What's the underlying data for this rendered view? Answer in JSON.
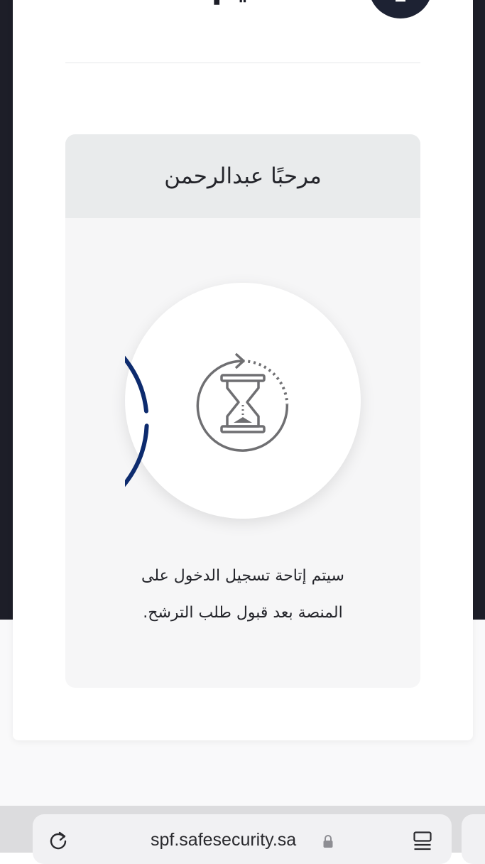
{
  "header": {
    "title": "التقديم",
    "icon": "monitor-download-icon"
  },
  "panel": {
    "welcome_text": "مرحبًا عبدالرحمن",
    "status_icon": "hourglass-refresh-icon",
    "message_line1": "سيتم إتاحة تسجيل الدخول على",
    "message_line2": "المنصة بعد قبول طلب الترشح."
  },
  "browser": {
    "url": "spf.safesecurity.sa",
    "reload_icon": "reload-icon",
    "lock_icon": "lock-icon",
    "tabs_icon": "tabs-icon"
  },
  "colors": {
    "page_dark": "#1d1e28",
    "accent_ring": "#0d2b6e",
    "icon_gray": "#6f6f72",
    "welcome_bg": "#e9ebec",
    "panel_bg": "#f6f6f7"
  }
}
